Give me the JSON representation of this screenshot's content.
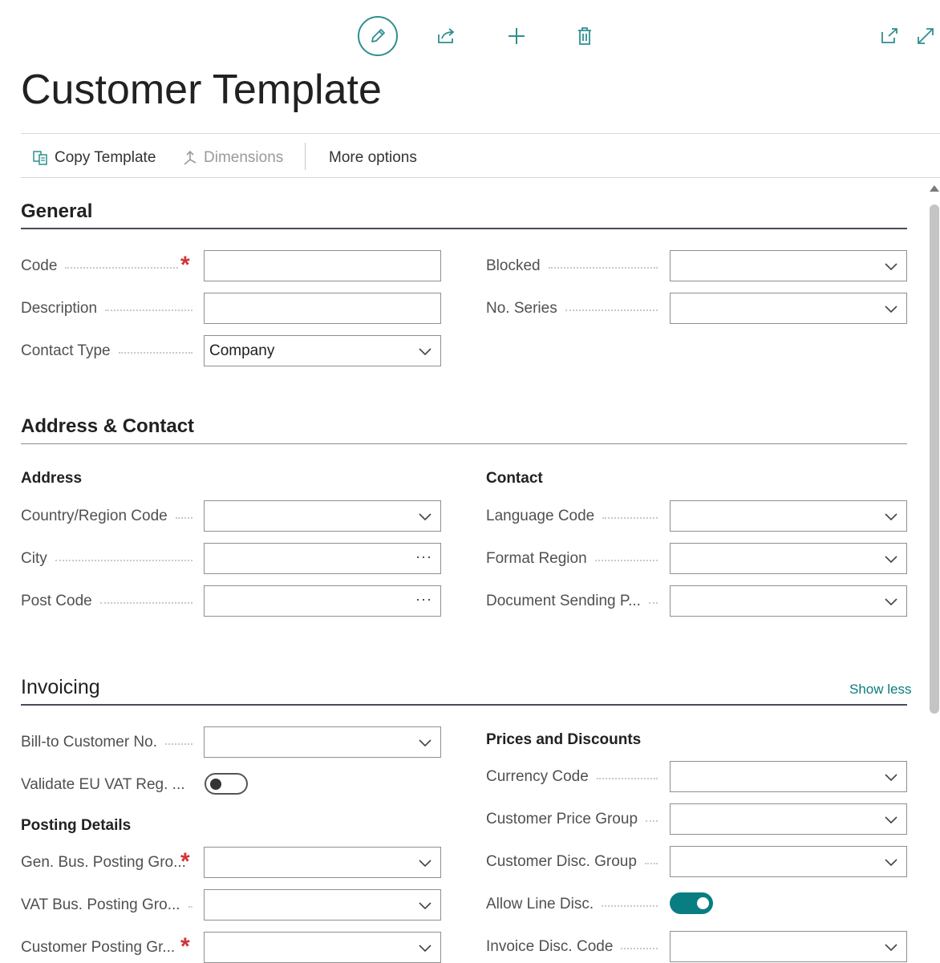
{
  "page": {
    "title": "Customer Template"
  },
  "colors": {
    "accent": "#097e82",
    "required": "#d13438",
    "section_rule": "#4a4a5a"
  },
  "top_icons": [
    "pencil-icon",
    "share-icon",
    "plus-icon",
    "delete-icon",
    "open-new-window-icon",
    "expand-icon"
  ],
  "actions": {
    "copy_template": "Copy Template",
    "dimensions": "Dimensions",
    "more_options": "More options"
  },
  "general": {
    "title": "General",
    "code": {
      "label": "Code",
      "value": ""
    },
    "description": {
      "label": "Description",
      "value": ""
    },
    "contact_type": {
      "label": "Contact Type",
      "value": "Company"
    },
    "blocked": {
      "label": "Blocked",
      "value": ""
    },
    "no_series": {
      "label": "No. Series",
      "value": ""
    }
  },
  "address_contact": {
    "title": "Address & Contact",
    "address_heading": "Address",
    "contact_heading": "Contact",
    "country_region_code": {
      "label": "Country/Region Code",
      "value": ""
    },
    "city": {
      "label": "City",
      "value": ""
    },
    "post_code": {
      "label": "Post Code",
      "value": ""
    },
    "language_code": {
      "label": "Language Code",
      "value": ""
    },
    "format_region": {
      "label": "Format Region",
      "value": ""
    },
    "document_sending": {
      "label": "Document Sending P...",
      "value": ""
    }
  },
  "invoicing": {
    "title": "Invoicing",
    "show_less": "Show less",
    "bill_to_customer_no": {
      "label": "Bill-to Customer No.",
      "value": ""
    },
    "validate_eu_vat": {
      "label": "Validate EU VAT Reg. ...",
      "checked": false
    },
    "posting_details_heading": "Posting Details",
    "gen_bus_posting": {
      "label": "Gen. Bus. Posting Gro...",
      "value": ""
    },
    "vat_bus_posting": {
      "label": "VAT Bus. Posting Gro...",
      "value": ""
    },
    "customer_posting": {
      "label": "Customer Posting Gr...",
      "value": ""
    },
    "prices_discounts_heading": "Prices and Discounts",
    "currency_code": {
      "label": "Currency Code",
      "value": ""
    },
    "customer_price_group": {
      "label": "Customer Price Group",
      "value": ""
    },
    "customer_disc_group": {
      "label": "Customer Disc. Group",
      "value": ""
    },
    "allow_line_disc": {
      "label": "Allow Line Disc.",
      "checked": true
    },
    "invoice_disc_code": {
      "label": "Invoice Disc. Code",
      "value": ""
    }
  }
}
